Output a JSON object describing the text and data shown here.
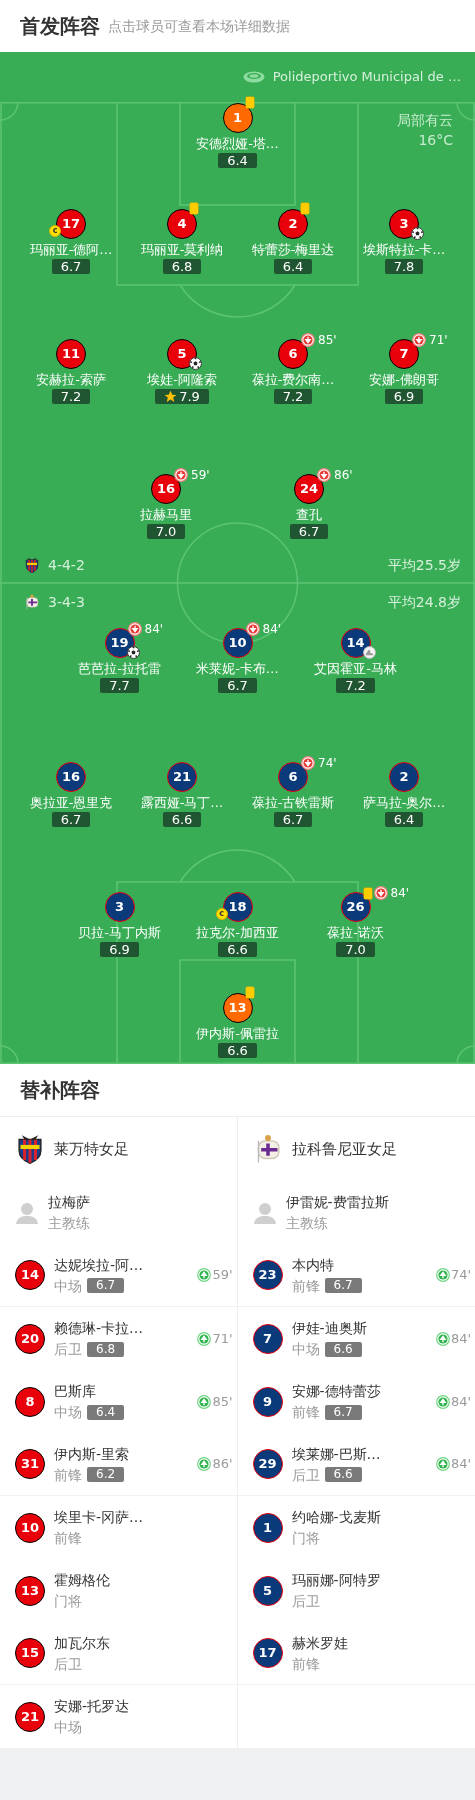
{
  "header": {
    "title": "首发阵容",
    "subtitle": "点击球员可查看本场详细数据"
  },
  "venue": "Polideportivo Municipal de …",
  "weather": {
    "condition": "局部有云",
    "temperature": "16°C"
  },
  "teams": [
    {
      "name": "莱万特女足",
      "color": "#e8000b",
      "formation": "4-4-2",
      "average_age": "平均25.5岁",
      "lines": [
        [
          {
            "number": "1",
            "name": "安德烈娅-塔…",
            "rating": "6.4",
            "goalkeeper": true,
            "events": [
              {
                "kind": "yellow_card"
              }
            ]
          }
        ],
        [
          {
            "number": "17",
            "name": "玛丽亚-德阿…",
            "rating": "6.7",
            "goalkeeper": false,
            "events": [
              {
                "kind": "captain",
                "label": "c"
              }
            ]
          },
          {
            "number": "4",
            "name": "玛丽亚-莫利纳",
            "rating": "6.8",
            "goalkeeper": false,
            "events": [
              {
                "kind": "yellow_card"
              }
            ]
          },
          {
            "number": "2",
            "name": "特蕾莎-梅里达",
            "rating": "6.4",
            "goalkeeper": false,
            "events": [
              {
                "kind": "yellow_card"
              }
            ]
          },
          {
            "number": "3",
            "name": "埃斯特拉-卡…",
            "rating": "7.8",
            "goalkeeper": false,
            "events": [
              {
                "kind": "goal"
              }
            ]
          }
        ],
        [
          {
            "number": "11",
            "name": "安赫拉-索萨",
            "rating": "7.2",
            "goalkeeper": false
          },
          {
            "number": "5",
            "name": "埃娃-阿隆索",
            "rating": "7.9",
            "goalkeeper": false,
            "events": [
              {
                "kind": "goal"
              },
              {
                "kind": "best_player"
              }
            ]
          },
          {
            "number": "6",
            "name": "葆拉-费尔南…",
            "rating": "7.2",
            "goalkeeper": false,
            "events": [
              {
                "kind": "sub_out",
                "minute": "85'"
              }
            ]
          },
          {
            "number": "7",
            "name": "安娜-佛朗哥",
            "rating": "6.9",
            "goalkeeper": false,
            "events": [
              {
                "kind": "sub_out",
                "minute": "71'"
              }
            ]
          }
        ],
        [
          {
            "number": "16",
            "name": "拉赫马里",
            "rating": "7.0",
            "goalkeeper": false,
            "events": [
              {
                "kind": "sub_out",
                "minute": "59'"
              }
            ]
          },
          {
            "number": "24",
            "name": "查孔",
            "rating": "6.7",
            "goalkeeper": false,
            "events": [
              {
                "kind": "sub_out",
                "minute": "86'"
              }
            ]
          }
        ]
      ],
      "coach": {
        "name": "拉梅萨",
        "role": "主教练"
      },
      "substitutes": [
        {
          "number": "14",
          "name": "达妮埃拉-阿…",
          "position": "中场",
          "rating": "6.7",
          "sub_in": "59'"
        },
        {
          "number": "20",
          "name": "赖德琳-卡拉…",
          "position": "后卫",
          "rating": "6.8",
          "sub_in": "71'"
        },
        {
          "number": "8",
          "name": "巴斯库",
          "position": "中场",
          "rating": "6.4",
          "sub_in": "85'"
        },
        {
          "number": "31",
          "name": "伊内斯-里索",
          "position": "前锋",
          "rating": "6.2",
          "sub_in": "86'"
        },
        {
          "number": "10",
          "name": "埃里卡-冈萨…",
          "position": "前锋"
        },
        {
          "number": "13",
          "name": "霍姆格伦",
          "position": "门将"
        },
        {
          "number": "15",
          "name": "加瓦尔东",
          "position": "后卫"
        },
        {
          "number": "21",
          "name": "安娜-托罗达",
          "position": "中场"
        }
      ]
    },
    {
      "name": "拉科鲁尼亚女足",
      "color": "#0a3a7a",
      "formation": "3-4-3",
      "average_age": "平均24.8岁",
      "lines": [
        [
          {
            "number": "19",
            "name": "芭芭拉-拉托雷",
            "rating": "7.7",
            "goalkeeper": false,
            "events": [
              {
                "kind": "sub_out",
                "minute": "84'"
              },
              {
                "kind": "goal"
              }
            ]
          },
          {
            "number": "10",
            "name": "米莱妮-卡布…",
            "rating": "6.7",
            "goalkeeper": false,
            "events": [
              {
                "kind": "sub_out",
                "minute": "84'"
              }
            ]
          },
          {
            "number": "14",
            "name": "艾因霍亚-马林",
            "rating": "7.2",
            "goalkeeper": false,
            "events": [
              {
                "kind": "assist"
              }
            ]
          }
        ],
        [
          {
            "number": "16",
            "name": "奥拉亚-恩里克",
            "rating": "6.7",
            "goalkeeper": false
          },
          {
            "number": "21",
            "name": "露西娅-马丁…",
            "rating": "6.6",
            "goalkeeper": false
          },
          {
            "number": "6",
            "name": "葆拉-古铁雷斯",
            "rating": "6.7",
            "goalkeeper": false,
            "events": [
              {
                "kind": "sub_out",
                "minute": "74'"
              }
            ]
          },
          {
            "number": "2",
            "name": "萨马拉-奥尔…",
            "rating": "6.4",
            "goalkeeper": false
          }
        ],
        [
          {
            "number": "3",
            "name": "贝拉-马丁内斯",
            "rating": "6.9",
            "goalkeeper": false
          },
          {
            "number": "18",
            "name": "拉克尔-加西亚",
            "rating": "6.6",
            "goalkeeper": false,
            "events": [
              {
                "kind": "captain",
                "label": "c"
              }
            ]
          },
          {
            "number": "26",
            "name": "葆拉-诺沃",
            "rating": "7.0",
            "goalkeeper": false,
            "events": [
              {
                "kind": "yellow_card"
              },
              {
                "kind": "sub_out",
                "minute": "84'"
              }
            ]
          }
        ],
        [
          {
            "number": "13",
            "name": "伊内斯-佩雷拉",
            "rating": "6.6",
            "goalkeeper": true,
            "events": [
              {
                "kind": "yellow_card"
              }
            ]
          }
        ]
      ],
      "coach": {
        "name": "伊雷妮-费雷拉斯",
        "role": "主教练"
      },
      "substitutes": [
        {
          "number": "23",
          "name": "本内特",
          "position": "前锋",
          "rating": "6.7",
          "sub_in": "74'"
        },
        {
          "number": "7",
          "name": "伊娃-迪奥斯",
          "position": "中场",
          "rating": "6.6",
          "sub_in": "84'"
        },
        {
          "number": "9",
          "name": "安娜-德特蕾莎",
          "position": "前锋",
          "rating": "6.7",
          "sub_in": "84'"
        },
        {
          "number": "29",
          "name": "埃莱娜-巴斯…",
          "position": "后卫",
          "rating": "6.6",
          "sub_in": "84'"
        },
        {
          "number": "1",
          "name": "约哈娜-戈麦斯",
          "position": "门将"
        },
        {
          "number": "5",
          "name": "玛丽娜-阿特罗",
          "position": "后卫"
        },
        {
          "number": "17",
          "name": "赫米罗娃",
          "position": "前锋"
        }
      ]
    }
  ],
  "bench_title": "替补阵容"
}
